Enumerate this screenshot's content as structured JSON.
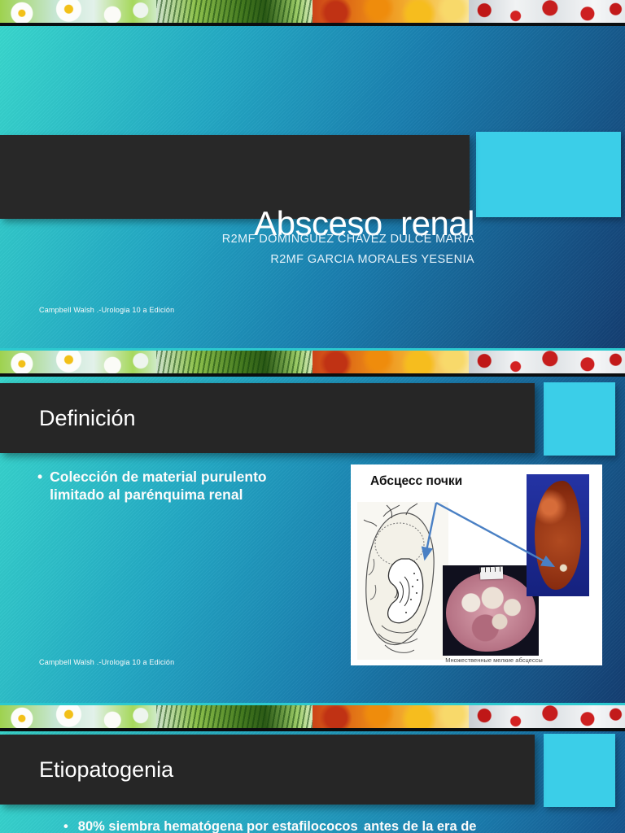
{
  "deck": {
    "bullet_marker": "•",
    "theme_colors": {
      "accent_cyan": "#3bcee8",
      "panel_dark": "#262626",
      "body_gradient_start": "#38d7cd",
      "body_gradient_mid": "#1a7fb0",
      "body_gradient_end": "#143e72",
      "strip_rule_black": "#0b0e10",
      "text_light": "#ffffff"
    },
    "photo_strip": [
      "daisies-photo",
      "palm-leaves-photo",
      "autumn-flowers-photo",
      "red-berries-photo"
    ]
  },
  "slide1": {
    "title": "Absceso  renal",
    "author_line1": "R2MF DOMINGUEZ CHAVEZ DULCE MARIA",
    "author_line2": "R2MF GARCIA MORALES YESENIA",
    "footnote": "Campbell Walsh .-Urologia 10 a Edición"
  },
  "slide2": {
    "heading": "Definición",
    "bullet": "Colección de material purulento limitado al parénquima renal",
    "footnote": "Campbell Walsh .-Urologia 10 a Edición",
    "figure": {
      "label": "Абсцесс почки",
      "caption": "Множественные мелкие абсцессы"
    }
  },
  "slide3": {
    "heading": "Etiopatogenia",
    "partial_bullet_left": "80%  siembra hematógena por estafilococos",
    "partial_bullet_right": "antes de la era de"
  }
}
